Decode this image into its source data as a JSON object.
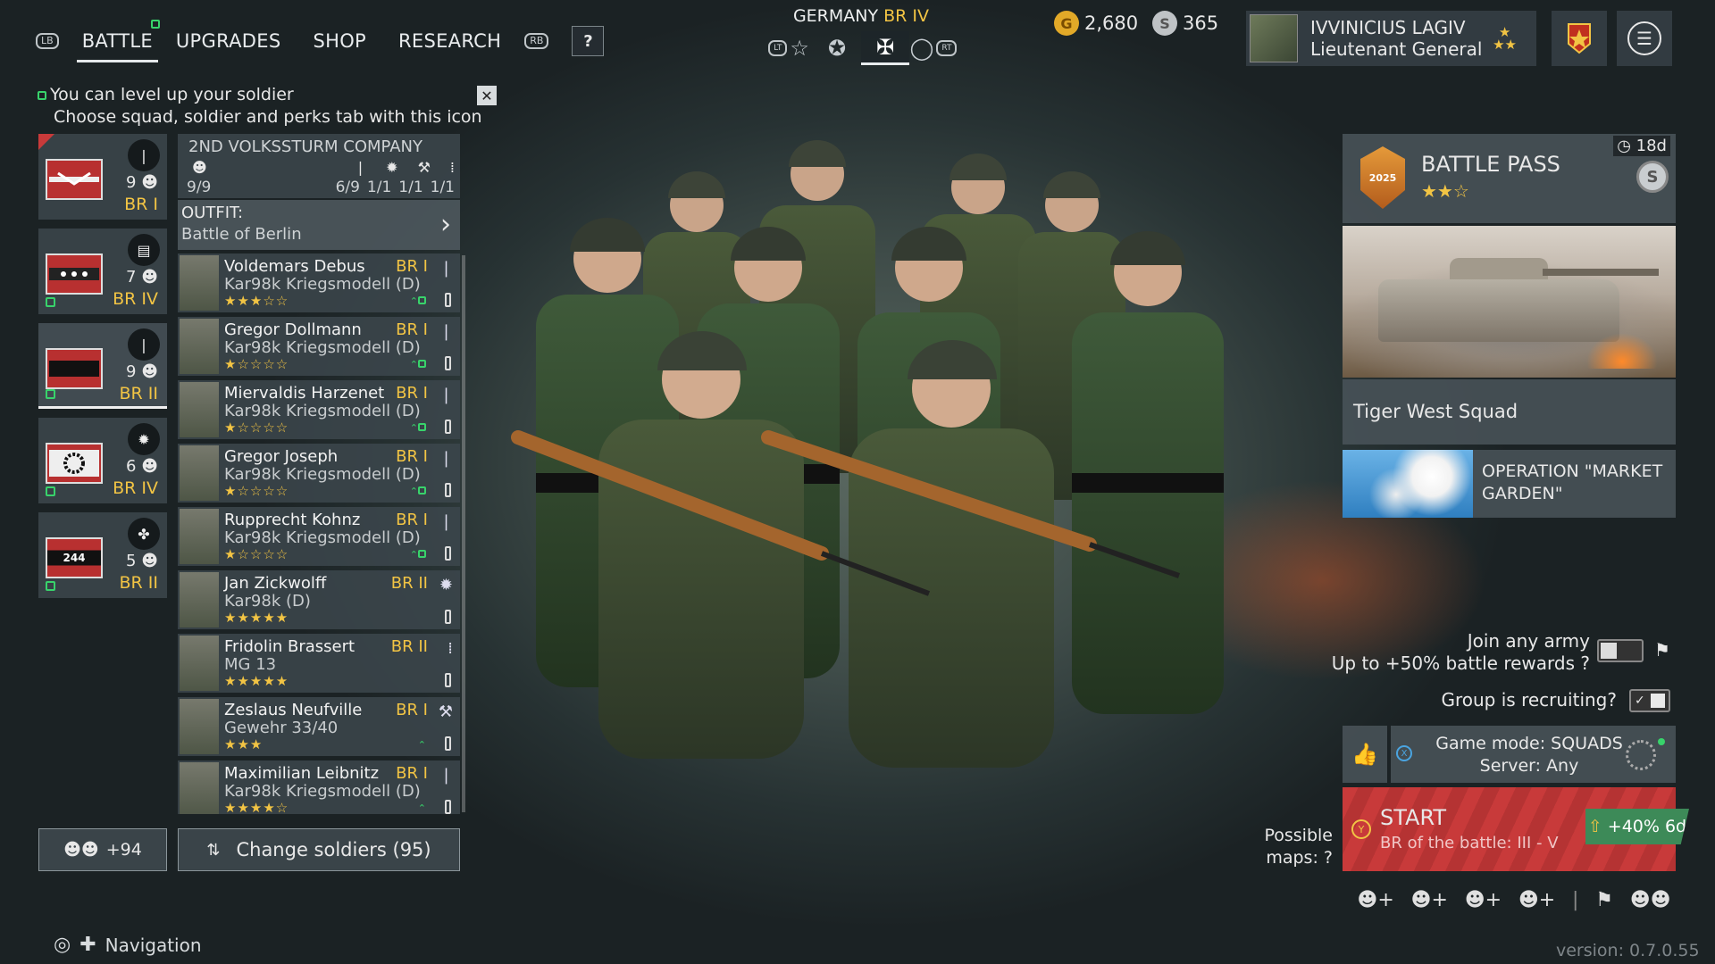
{
  "topnav": {
    "lb": "LB",
    "rb": "RB",
    "tabs": [
      {
        "label": "BATTLE"
      },
      {
        "label": "UPGRADES"
      },
      {
        "label": "SHOP"
      },
      {
        "label": "RESEARCH"
      }
    ],
    "help_label": "?"
  },
  "nation": {
    "country": "GERMANY",
    "br": "BR IV",
    "lt": "LT",
    "rt": "RT"
  },
  "currency": {
    "gold": "2,680",
    "silver": "365"
  },
  "profile": {
    "name": "IVVINICIUS LAGIV",
    "rank": "Lieutenant General"
  },
  "hint": {
    "line1": "You can level up your soldier",
    "line2": "Choose squad, soldier and perks tab with this icon",
    "close": "✕"
  },
  "squads": [
    {
      "count": "9",
      "br": "BR I",
      "flag_text": ""
    },
    {
      "count": "7",
      "br": "BR IV",
      "flag_text": ""
    },
    {
      "count": "9",
      "br": "BR II",
      "flag_text": ""
    },
    {
      "count": "6",
      "br": "BR IV",
      "flag_text": ""
    },
    {
      "count": "5",
      "br": "BR II",
      "flag_text": "244"
    }
  ],
  "squad_panel": {
    "title": "2ND VOLKSSTURM COMPANY",
    "stats": [
      "9/9",
      "6/9",
      "1/1",
      "1/1",
      "1/1"
    ],
    "outfit_label": "OUTFIT:",
    "outfit_value": "Battle of Berlin"
  },
  "soldiers": [
    {
      "name": "Voldemars Debus",
      "weapon": "Kar98k Kriegsmodell (D)",
      "br": "BR I",
      "stars": "★★★☆☆"
    },
    {
      "name": "Gregor Dollmann",
      "weapon": "Kar98k Kriegsmodell (D)",
      "br": "BR I",
      "stars": "★☆☆☆☆"
    },
    {
      "name": "Miervaldis Harzenet",
      "weapon": "Kar98k Kriegsmodell (D)",
      "br": "BR I",
      "stars": "★☆☆☆☆"
    },
    {
      "name": "Gregor Joseph",
      "weapon": "Kar98k Kriegsmodell (D)",
      "br": "BR I",
      "stars": "★☆☆☆☆"
    },
    {
      "name": "Rupprecht Kohnz",
      "weapon": "Kar98k Kriegsmodell (D)",
      "br": "BR I",
      "stars": "★☆☆☆☆"
    },
    {
      "name": "Jan Zickwolff",
      "weapon": "Kar98k (D)",
      "br": "BR II",
      "stars": "★★★★★"
    },
    {
      "name": "Fridolin Brassert",
      "weapon": "MG 13",
      "br": "BR II",
      "stars": "★★★★★"
    },
    {
      "name": "Zeslaus Neufville",
      "weapon": "Gewehr 33/40",
      "br": "BR I",
      "stars": "★★★"
    },
    {
      "name": "Maximilian Leibnitz",
      "weapon": "Kar98k Kriegsmodell (D)",
      "br": "BR I",
      "stars": "★★★★☆"
    }
  ],
  "bottom_left": {
    "reserve": "+94",
    "change_soldiers": "Change soldiers (95)",
    "navigation": "Navigation"
  },
  "battle_pass": {
    "title": "BATTLE PASS",
    "emblem": "2025",
    "timer": "18d",
    "stars": "★★☆",
    "coin": "S"
  },
  "event": {
    "title": "Tiger West Squad"
  },
  "operation": {
    "title_line1": "OPERATION \"MARKET",
    "title_line2": "GARDEN\""
  },
  "join": {
    "line1": "Join any army",
    "line2": "Up to +50% battle rewards"
  },
  "recruit": {
    "label": "Group is recruiting"
  },
  "mode": {
    "line1": "Game mode: SQUADS",
    "line2": "Server: Any"
  },
  "maps": {
    "line1": "Possible",
    "line2": "maps:"
  },
  "start": {
    "label": "START",
    "sub": "BR of the battle: III - V",
    "boost": "+40% 6d"
  },
  "version": "version: 0.7.0.55",
  "colors": {
    "gold": "#f2c444",
    "accent_green": "#38d36b",
    "start_red": "#c83a3a"
  }
}
